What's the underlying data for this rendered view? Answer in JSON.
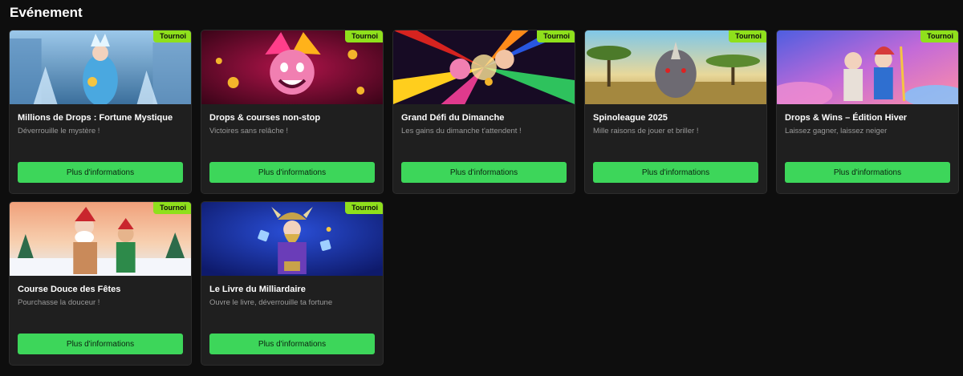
{
  "section": {
    "title": "Evénement"
  },
  "cards": [
    {
      "badge": "Tournoi",
      "title": "Millions de Drops : Fortune Mystique",
      "subtitle": "Déverrouille le mystère !",
      "cta": "Plus d'informations",
      "image": "ice-queen-illustration"
    },
    {
      "badge": "Tournoi",
      "title": "Drops & courses non-stop",
      "subtitle": "Victoires sans relâche !",
      "cta": "Plus d'informations",
      "image": "jester-illustration"
    },
    {
      "badge": "Tournoi",
      "title": "Grand Défi du Dimanche",
      "subtitle": "Les gains du dimanche t'attendent !",
      "cta": "Plus d'informations",
      "image": "jesters-burst-illustration"
    },
    {
      "badge": "Tournoi",
      "title": "Spinoleague 2025",
      "subtitle": "Mille raisons de jouer et briller !",
      "cta": "Plus d'informations",
      "image": "rhino-savanna-illustration"
    },
    {
      "badge": "Tournoi",
      "title": "Drops & Wins – Édition Hiver",
      "subtitle": "Laissez gagner, laissez neiger",
      "cta": "Plus d'informations",
      "image": "gods-winter-illustration"
    },
    {
      "badge": "Tournoi",
      "title": "Course Douce des Fêtes",
      "subtitle": "Pourchasse la douceur !",
      "cta": "Plus d'informations",
      "image": "santa-snow-illustration"
    },
    {
      "badge": "Tournoi",
      "title": "Le Livre du Milliardaire",
      "subtitle": "Ouvre le livre, déverrouille ta fortune",
      "cta": "Plus d'informations",
      "image": "viking-book-illustration"
    }
  ],
  "colors": {
    "badge": "#8fe01c",
    "button": "#3dd65a",
    "card": "#1f1f1f",
    "background": "#0e0e0e"
  }
}
